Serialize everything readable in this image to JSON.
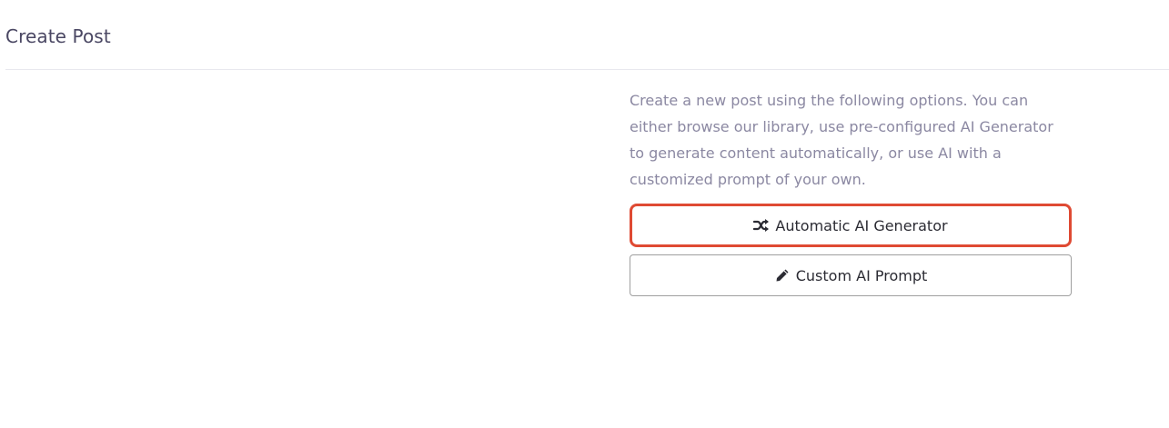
{
  "header": {
    "title": "Create Post"
  },
  "panel": {
    "description": "Create a new post using the following options. You can either browse our library, use pre-configured AI Generator to generate content automatically, or use AI with a customized prompt of your own.",
    "buttons": [
      {
        "label": "Automatic AI Generator",
        "icon": "shuffle-icon",
        "highlighted": true,
        "highlight_color": "#df4a33"
      },
      {
        "label": "Custom AI Prompt",
        "icon": "pencil-icon",
        "highlighted": false
      }
    ]
  }
}
